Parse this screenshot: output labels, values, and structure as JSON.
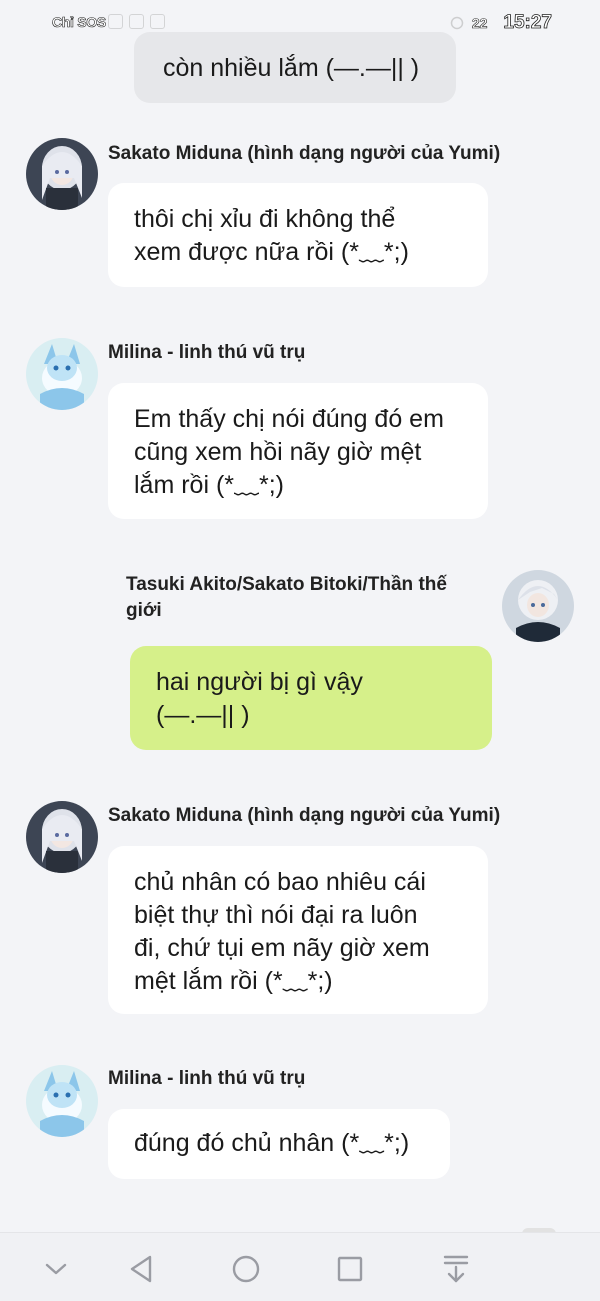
{
  "status_bar": {
    "carrier": "Chỉ SOS",
    "battery": "22",
    "time": "15:27"
  },
  "messages": [
    {
      "sender": "",
      "text_lines": [
        "còn nhiều lắm (—.—|| )"
      ],
      "side": "center"
    },
    {
      "sender": "Sakato Miduna (hình dạng người của Yumi)",
      "text_lines": [
        "thôi chị xỉu đi không thể",
        "xem được nữa rồi (*﹏*;)"
      ],
      "side": "left"
    },
    {
      "sender": "Milina - linh thú vũ trụ",
      "text_lines": [
        "Em thấy chị nói đúng đó em",
        "cũng xem hồi nãy giờ mệt",
        "lắm rồi (*﹏*;)"
      ],
      "side": "left"
    },
    {
      "sender_lines": [
        "Tasuki Akito/Sakato Bitoki/Thần thế",
        "giới"
      ],
      "text_lines": [
        "hai người bị gì vậy",
        "(—.—|| )"
      ],
      "side": "right"
    },
    {
      "sender": "Sakato Miduna (hình dạng người của Yumi)",
      "text_lines": [
        "chủ nhân có bao nhiêu cái",
        "biệt thự thì nói đại ra luôn",
        "đi, chứ tụi em nãy giờ xem",
        "mệt lắm rồi (*﹏*;)"
      ],
      "side": "left"
    },
    {
      "sender": "Milina - linh thú vũ trụ",
      "text_lines": [
        "đúng đó chủ nhân (*﹏*;)"
      ],
      "side": "left"
    }
  ],
  "nav_bar": {
    "icons": [
      "chevron-down-icon",
      "back-triangle-icon",
      "home-circle-icon",
      "recents-square-icon",
      "download-icon"
    ]
  }
}
